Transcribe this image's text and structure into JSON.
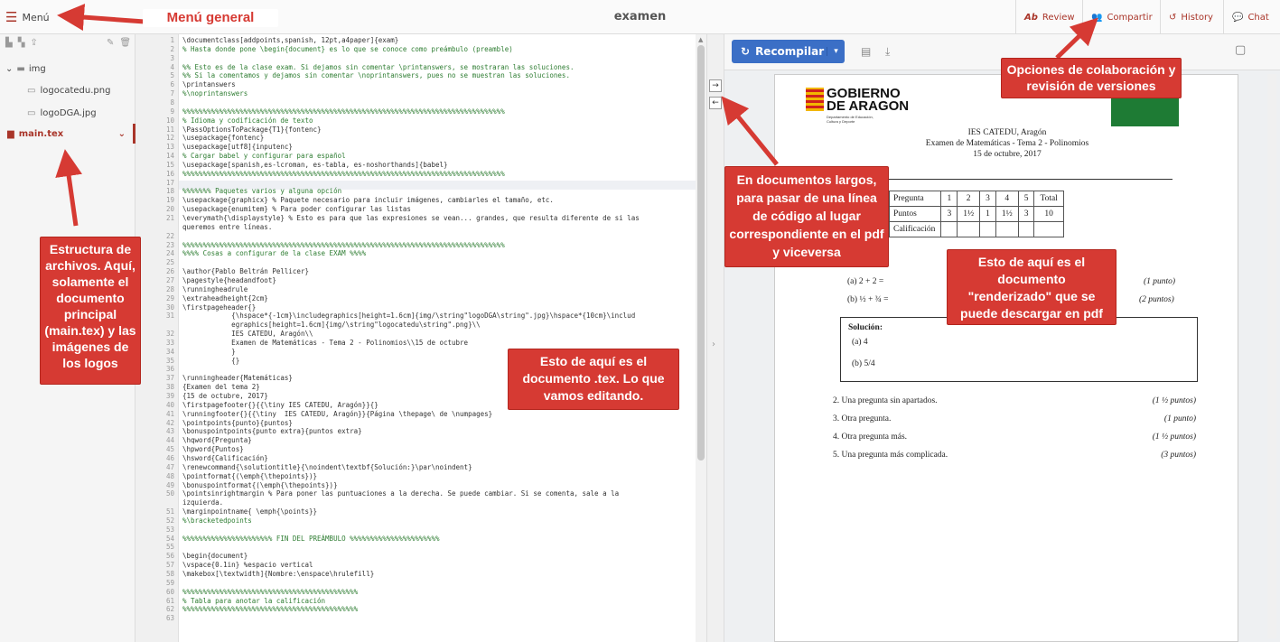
{
  "topbar": {
    "menu_label": "Menú",
    "title": "examen",
    "review": "Review",
    "share": "Compartir",
    "history": "History",
    "chat": "Chat"
  },
  "sidebar": {
    "folder": "img",
    "files": [
      "logocatedu.png",
      "logoDGA.jpg"
    ],
    "main": "main.tex"
  },
  "editor": {
    "line_numbers": [
      "1",
      "2",
      "3",
      "4",
      "5",
      "6",
      "7",
      "8",
      "9",
      "10",
      "11",
      "12",
      "13",
      "14",
      "15",
      "16",
      "17",
      "18",
      "19",
      "20",
      "21",
      "",
      "22",
      "23",
      "24",
      "25",
      "26",
      "27",
      "28",
      "29",
      "30",
      "31",
      "",
      "32",
      "33",
      "34",
      "35",
      "36",
      "37",
      "38",
      "39",
      "40",
      "41",
      "42",
      "43",
      "44",
      "45",
      "46",
      "47",
      "48",
      "49",
      "50",
      "",
      "51",
      "52",
      "53",
      "54",
      "55",
      "56",
      "57",
      "58",
      "59",
      "60",
      "61",
      "62",
      "63"
    ],
    "lines": [
      "\\documentclass[addpoints,spanish, 12pt,a4paper]{exam}",
      "% Hasta donde pone \\begin{document} es lo que se conoce como preámbulo (preamble)",
      "",
      "%% Esto es de la clase exam. Si dejamos sin comentar \\printanswers, se mostraran las soluciones.",
      "%% Si la comentamos y dejamos sin comentar \\noprintanswers, pues no se muestran las soluciones.",
      "\\printanswers",
      "%\\noprintanswers",
      "",
      "%%%%%%%%%%%%%%%%%%%%%%%%%%%%%%%%%%%%%%%%%%%%%%%%%%%%%%%%%%%%%%%%%%%%%%%%%%%%%%%",
      "% Idioma y codificación de texto",
      "\\PassOptionsToPackage{T1}{fontenc}",
      "\\usepackage{fontenc}",
      "\\usepackage[utf8]{inputenc}",
      "% Cargar babel y configurar para español",
      "\\usepackage[spanish,es-lcroman, es-tabla, es-noshorthands]{babel}",
      "%%%%%%%%%%%%%%%%%%%%%%%%%%%%%%%%%%%%%%%%%%%%%%%%%%%%%%%%%%%%%%%%%%%%%%%%%%%%%%%",
      "",
      "%%%%%%% Paquetes varios y alguna opción",
      "\\usepackage{graphicx} % Paquete necesario para incluir imágenes, cambiarles el tamaño, etc.",
      "\\usepackage{enumitem} % Para poder configurar las listas",
      "\\everymath{\\displaystyle} % Esto es para que las expresiones se vean... grandes, que resulta diferente de si las",
      "queremos entre líneas.",
      "",
      "%%%%%%%%%%%%%%%%%%%%%%%%%%%%%%%%%%%%%%%%%%%%%%%%%%%%%%%%%%%%%%%%%%%%%%%%%%%%%%%",
      "%%%% Cosas a configurar de la clase EXAM %%%%",
      "",
      "\\author{Pablo Beltrán Pellicer}",
      "\\pagestyle{headandfoot}",
      "\\runningheadrule",
      "\\extraheadheight{2cm}",
      "\\firstpageheader{}",
      "            {\\hspace*{-1cm}\\includegraphics[height=1.6cm]{img/\\string\"logoDGA\\string\".jpg}\\hspace*{10cm}\\includ",
      "            egraphics[height=1.6cm]{img/\\string\"logocatedu\\string\".png}\\\\",
      "            IES CATEDU, Aragón\\\\",
      "            Examen de Matemáticas - Tema 2 - Polinomios\\\\15 de octubre",
      "            }",
      "            {}",
      "",
      "\\runningheader{Matemáticas}",
      "{Examen del tema 2}",
      "{15 de octubre, 2017}",
      "\\firstpagefooter{}{{\\tiny IES CATEDU, Aragón}}{}",
      "\\runningfooter{}{{\\tiny  IES CATEDU, Aragón}}{Página \\thepage\\ de \\numpages}",
      "\\pointpoints{punto}{puntos}",
      "\\bonuspointpoints{punto extra}{puntos extra}",
      "\\hqword{Pregunta}",
      "\\hpword{Puntos}",
      "\\hsword{Calificación}",
      "\\renewcommand{\\solutiontitle}{\\noindent\\textbf{Solución:}\\par\\noindent}",
      "\\pointformat{(\\emph{\\thepoints})}",
      "\\bonuspointformat{(\\emph{\\thepoints})}",
      "\\pointsinrightmargin % Para poner las puntuaciones a la derecha. Se puede cambiar. Si se comenta, sale a la",
      "izquierda.",
      "\\marginpointname{ \\emph{\\points}}",
      "%\\bracketedpoints",
      "",
      "%%%%%%%%%%%%%%%%%%%%%% FIN DEL PREÁMBULO %%%%%%%%%%%%%%%%%%%%%%",
      "",
      "\\begin{document}",
      "\\vspace{0.1in} %espacio vertical",
      "\\makebox[\\textwidth]{Nombre:\\enspace\\hrulefill}",
      "",
      "%%%%%%%%%%%%%%%%%%%%%%%%%%%%%%%%%%%%%%%%%%%",
      "% Tabla para anotar la calificación",
      "%%%%%%%%%%%%%%%%%%%%%%%%%%%%%%%%%%%%%%%%%%%",
      ""
    ]
  },
  "pdf": {
    "recompile": "Recompilar",
    "logo_line1": "GOBIERNO",
    "logo_line2": "DE ARAGON",
    "logo_sub": "Departamento de Educación, Cultura y Deporte",
    "header1": "IES CATEDU, Aragón",
    "header2": "Examen de Matemáticas - Tema 2 - Polinomios",
    "header3": "15 de octubre, 2017",
    "table": {
      "rows": [
        [
          "Pregunta",
          "1",
          "2",
          "3",
          "4",
          "5",
          "Total"
        ],
        [
          "Puntos",
          "3",
          "1½",
          "1",
          "1½",
          "3",
          "10"
        ],
        [
          "Calificación",
          "",
          "",
          "",
          "",
          "",
          ""
        ]
      ]
    },
    "q1a": "(a)  2 + 2 =",
    "q1a_pts": "(1 punto)",
    "q1b": "(b)  ½ + ¾ =",
    "q1b_pts": "(2 puntos)",
    "solution_title": "Solución:",
    "sol_a": "(a)  4",
    "sol_b": "(b)  5/4",
    "questions": [
      {
        "text": "2. Una pregunta sin apartados.",
        "pts": "(1 ½ puntos)"
      },
      {
        "text": "3. Otra pregunta.",
        "pts": "(1 punto)"
      },
      {
        "text": "4. Otra pregunta más.",
        "pts": "(1 ½ puntos)"
      },
      {
        "text": "5. Una pregunta más complicada.",
        "pts": "(3 puntos)"
      }
    ]
  },
  "callouts": {
    "menu": "Menú general",
    "collab": "Opciones de colaboración y revisión de versiones",
    "files": "Estructura de archivos. Aquí, solamente el documento principal (main.tex) y las imágenes de los logos",
    "tex": "Esto de aquí es el documento .tex. Lo que vamos editando.",
    "sync": "En documentos largos, para pasar de una línea de código al lugar correspondiente en el pdf y viceversa",
    "pdf": "Esto de aquí es el documento \"renderizado\" que se puede descargar en pdf"
  },
  "colors": {
    "accent": "#a93529",
    "callout": "#d63a33",
    "recompile": "#3b6fc6"
  }
}
